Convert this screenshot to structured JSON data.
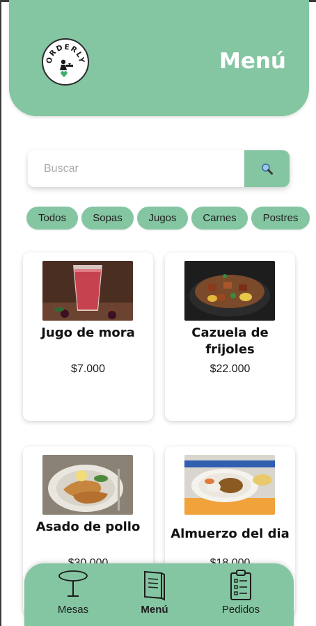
{
  "header": {
    "logo_text": "ORDERLY",
    "title": "Menú"
  },
  "search": {
    "placeholder": "Buscar",
    "value": ""
  },
  "filters": [
    "Todos",
    "Sopas",
    "Jugos",
    "Carnes",
    "Postres"
  ],
  "products": [
    {
      "name": "Jugo de mora",
      "price": "$7.000"
    },
    {
      "name": "Cazuela de frijoles",
      "price": "$22.000"
    },
    {
      "name": "Asado de pollo",
      "price": "$30.000"
    },
    {
      "name": "Almuerzo del dia",
      "price": "$18.000"
    }
  ],
  "nav": {
    "items": [
      {
        "label": "Mesas",
        "icon": "table-icon",
        "active": false
      },
      {
        "label": "Menú",
        "icon": "menu-book-icon",
        "active": true
      },
      {
        "label": "Pedidos",
        "icon": "clipboard-list-icon",
        "active": false
      }
    ]
  },
  "colors": {
    "accent": "#84c5a2",
    "background": "#ffffff",
    "text": "#111111"
  }
}
